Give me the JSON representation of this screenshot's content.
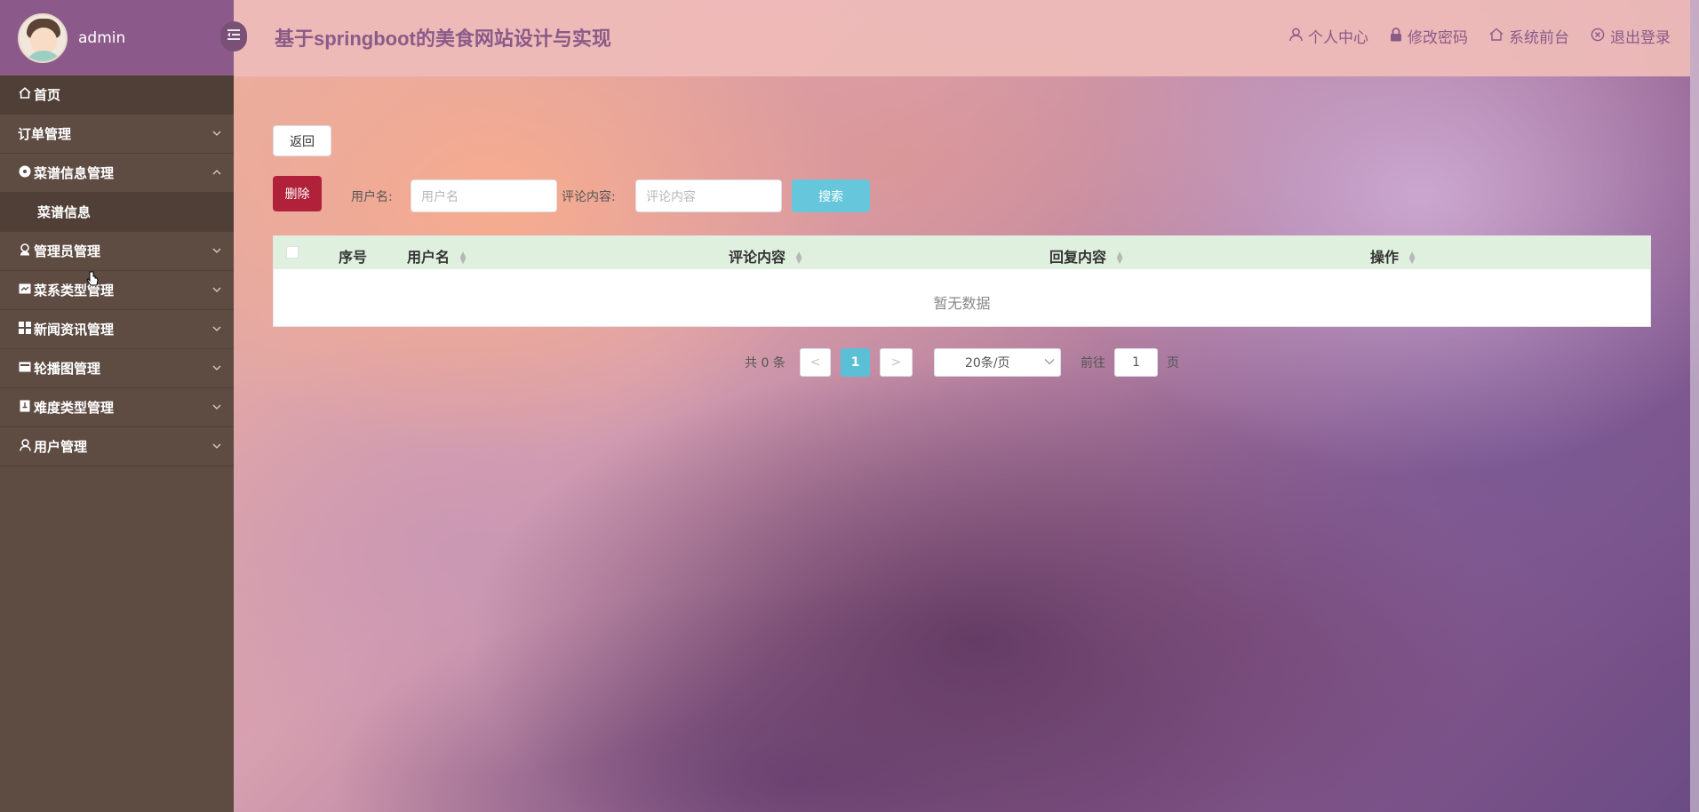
{
  "app": {
    "title": "基于springboot的美食网站设计与实现",
    "user_name": "admin"
  },
  "header_links": [
    {
      "label": "个人中心",
      "icon": "user-icon"
    },
    {
      "label": "修改密码",
      "icon": "lock-icon"
    },
    {
      "label": "系统前台",
      "icon": "home-icon"
    },
    {
      "label": "退出登录",
      "icon": "close-circle-icon"
    }
  ],
  "sidebar": {
    "items": [
      {
        "label": "首页",
        "icon": "home-icon"
      },
      {
        "label": "订单管理",
        "icon": ""
      },
      {
        "label": "菜谱信息管理",
        "icon": "disc-icon",
        "expanded": true
      },
      {
        "label": "菜谱信息",
        "submenu": true
      },
      {
        "label": "管理员管理",
        "icon": "admin-icon"
      },
      {
        "label": "菜系类型管理",
        "icon": "tag-icon"
      },
      {
        "label": "新闻资讯管理",
        "icon": "grid-icon"
      },
      {
        "label": "轮播图管理",
        "icon": "image-icon"
      },
      {
        "label": "难度类型管理",
        "icon": "doc-icon"
      },
      {
        "label": "用户管理",
        "icon": "user-icon"
      }
    ]
  },
  "toolbar": {
    "back_label": "返回",
    "delete_label": "删除",
    "username_label": "用户名:",
    "username_placeholder": "用户名",
    "comment_label": "评论内容:",
    "comment_placeholder": "评论内容",
    "search_label": "搜索"
  },
  "table": {
    "columns": [
      "序号",
      "用户名",
      "评论内容",
      "回复内容",
      "操作"
    ],
    "empty_text": "暂无数据"
  },
  "pagination": {
    "total_text": "共 0 条",
    "prev": "<",
    "current_page": "1",
    "next": ">",
    "page_size": "20条/页",
    "goto_label": "前往",
    "goto_value": "1",
    "page_suffix": "页"
  },
  "colors": {
    "sidebar_bg": "#5e4c43",
    "sidebar_header": "#8b5a8a",
    "title_color": "#8a5a89",
    "delete_btn": "#b1213a",
    "search_btn": "#66c7dc",
    "table_header": "#dff0df"
  }
}
